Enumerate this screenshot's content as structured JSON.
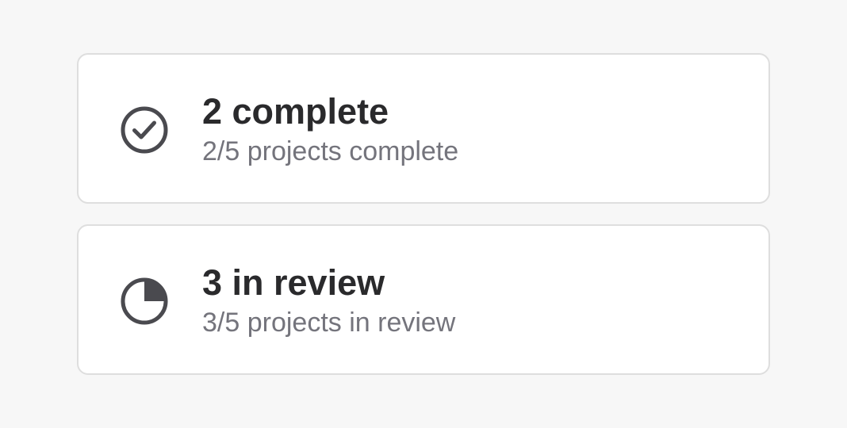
{
  "cards": [
    {
      "icon": "check-circle-icon",
      "title": "2 complete",
      "subtitle": "2/5 projects complete"
    },
    {
      "icon": "pie-chart-icon",
      "title": "3 in review",
      "subtitle": "3/5 projects in review"
    }
  ],
  "colors": {
    "icon": "#4a4a4f",
    "title": "#2a2a2c",
    "subtitle": "#74747c",
    "card_border": "#dedede",
    "background": "#f7f7f7"
  }
}
